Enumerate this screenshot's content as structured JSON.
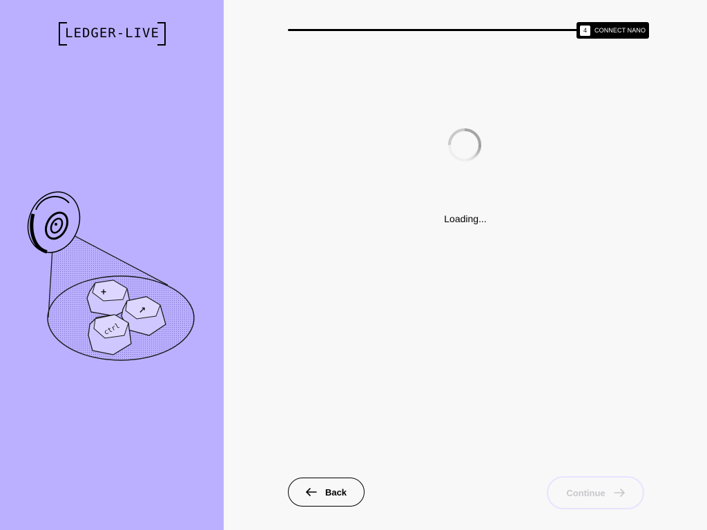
{
  "brand": {
    "logo_text": "LEDGER-LIVE",
    "panel_color": "#bbb0ff"
  },
  "progress": {
    "step_number": "4",
    "step_label": "CONNECT NANO",
    "fraction_complete": 1.0
  },
  "main": {
    "status_text": "Loading..."
  },
  "footer": {
    "back_label": "Back",
    "continue_label": "Continue",
    "continue_enabled": false
  },
  "illustration": {
    "keycaps": [
      "+",
      "↗",
      "ctrl"
    ]
  },
  "icons": {
    "back": "arrow-left-icon",
    "continue": "arrow-right-icon",
    "spinner": "loading-spinner-icon"
  }
}
